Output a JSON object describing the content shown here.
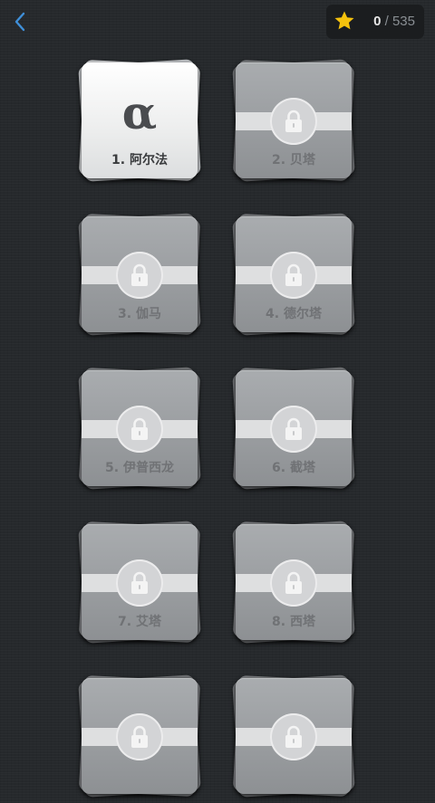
{
  "header": {
    "back_icon": "chevron-left-icon",
    "star_icon": "star-icon",
    "score_current": "0",
    "score_separator": " / ",
    "score_total": "535"
  },
  "levels": [
    {
      "label": "1. 阿尔法",
      "glyph": "α",
      "locked": false
    },
    {
      "label": "2. 贝塔",
      "locked": true
    },
    {
      "label": "3. 伽马",
      "locked": true
    },
    {
      "label": "4. 德尔塔",
      "locked": true
    },
    {
      "label": "5. 伊普西龙",
      "locked": true
    },
    {
      "label": "6. 截塔",
      "locked": true
    },
    {
      "label": "7. 艾塔",
      "locked": true
    },
    {
      "label": "8. 西塔",
      "locked": true
    },
    {
      "label": "",
      "locked": true
    },
    {
      "label": "",
      "locked": true
    }
  ],
  "colors": {
    "accent": "#3f8fd8",
    "star": "#f5c20d"
  }
}
